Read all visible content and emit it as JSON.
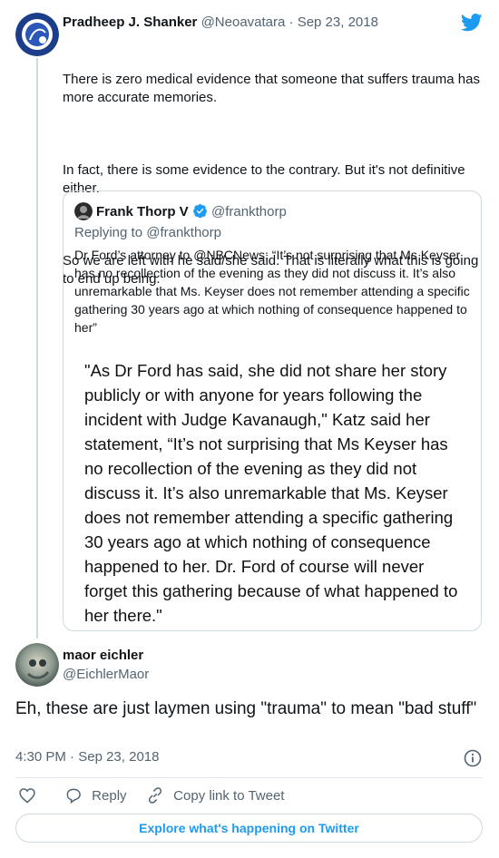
{
  "parent_tweet": {
    "author_name": "Pradheep J. Shanker",
    "handle": "@Neoavatara",
    "separator": "·",
    "date": "Sep 23, 2018",
    "paragraphs": [
      "There is zero medical evidence that someone that suffers trauma has more accurate memories.",
      "In fact, there is some evidence to the contrary. But it's not definitive either.",
      "So we are left with he said/she said. That is literally what this is going to end up being."
    ]
  },
  "quoted_tweet": {
    "author_name": "Frank Thorp V",
    "handle": "@frankthorp",
    "replying_to": "Replying to @frankthorp",
    "text": "Dr Ford’s attorney to @NBCNews: “It’s not surprising that Ms Keyser has no recollection of the evening as they did not discuss it. It’s also unremarkable that Ms. Keyser does not remember attending a specific gathering 30 years ago at which nothing of consequence happened to her”",
    "image_text": "\"As Dr Ford has said, she did not share her story publicly or with anyone for years following the incident with Judge Kavanaugh,\" Katz said her statement, “It’s not surprising that Ms Keyser has no recollection of the evening as they did not discuss it. It’s also unremarkable that Ms. Keyser does not remember attending a specific gathering 30 years ago at which nothing of consequence happened to her.  Dr. Ford of course will never forget this gathering because of what happened to her there.\""
  },
  "main_tweet": {
    "author_name": "maor eichler",
    "handle": "@EichlerMaor",
    "text": "Eh, these are just laymen using \"trauma\" to mean \"bad stuff\"",
    "time": "4:30 PM",
    "separator": "·",
    "date": "Sep 23, 2018"
  },
  "actions": {
    "reply": "Reply",
    "copy_link": "Copy link to Tweet"
  },
  "explore_button": "Explore what's happening on Twitter",
  "colors": {
    "twitter_blue": "#1d9bf0",
    "text": "#0f1419",
    "muted": "#536471",
    "border": "#cfd9de"
  },
  "icons": {
    "brand": "twitter-bird-icon",
    "verified": "verified-badge-icon",
    "info": "info-icon",
    "like": "heart-icon",
    "reply": "reply-icon",
    "copy": "link-icon"
  }
}
